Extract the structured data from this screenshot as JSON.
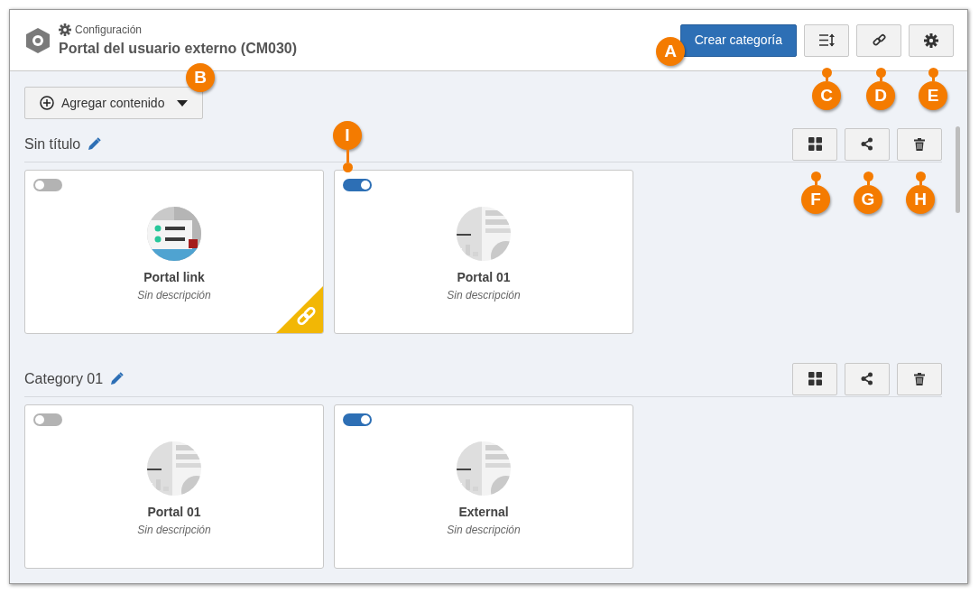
{
  "header": {
    "breadcrumb": "Configuración",
    "title": "Portal del usuario externo (CM030)",
    "primary_button": "Crear categoría",
    "tool_buttons": [
      {
        "kind": "sort"
      },
      {
        "kind": "link"
      },
      {
        "kind": "settings"
      }
    ]
  },
  "add_button": {
    "label": "Agregar contenido"
  },
  "categories": [
    {
      "title": "Sin título",
      "cards": [
        {
          "title": "Portal link",
          "description": "Sin descripción",
          "enabled": false,
          "kind": "link"
        },
        {
          "title": "Portal 01",
          "description": "Sin descripción",
          "enabled": true,
          "kind": "page"
        }
      ]
    },
    {
      "title": "Category 01",
      "cards": [
        {
          "title": "Portal 01",
          "description": "Sin descripción",
          "enabled": false,
          "kind": "page"
        },
        {
          "title": "External",
          "description": "Sin descripción",
          "enabled": true,
          "kind": "page"
        }
      ]
    }
  ],
  "callouts": [
    {
      "label": "A"
    },
    {
      "label": "B"
    },
    {
      "label": "C"
    },
    {
      "label": "D"
    },
    {
      "label": "E"
    },
    {
      "label": "F"
    },
    {
      "label": "G"
    },
    {
      "label": "H"
    },
    {
      "label": "I"
    }
  ]
}
